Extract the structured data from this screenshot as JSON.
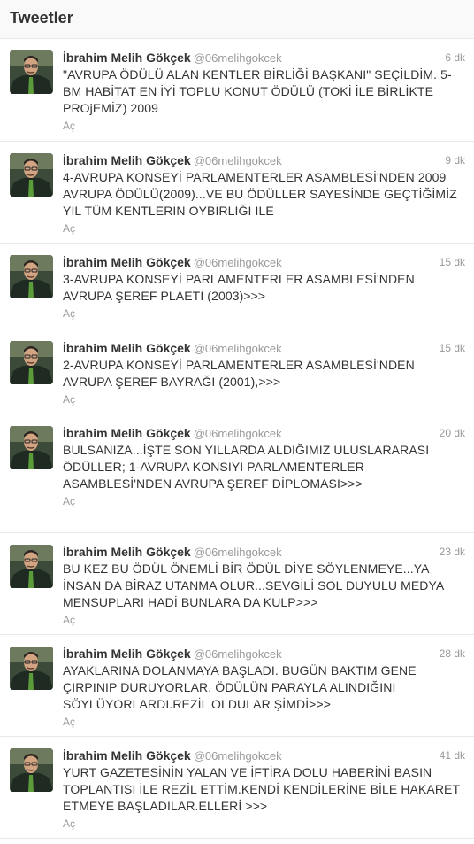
{
  "header": {
    "title": "Tweetler"
  },
  "author": {
    "name": "İbrahim Melih Gökçek",
    "handle": "@06melihgokcek"
  },
  "open_label": "Aç",
  "tweets": [
    {
      "time": "6 dk",
      "text": "\"AVRUPA ÖDÜLÜ ALAN KENTLER BİRLİĞİ BAŞKANI\" SEÇİLDİM. 5-BM HABİTAT EN İYİ TOPLU KONUT ÖDÜLÜ (TOKİ İLE BİRLİKTE PROjEMİZ) 2009"
    },
    {
      "time": "9 dk",
      "text": "4-AVRUPA KONSEYİ PARLAMENTERLER ASAMBLESİ'NDEN 2009 AVRUPA ÖDÜLÜ(2009)...VE BU ÖDÜLLER SAYESİNDE GEÇTİĞİMİZ YIL TÜM KENTLERİN OYBİRLİĞİ İLE"
    },
    {
      "time": "15 dk",
      "text": "3-AVRUPA KONSEYİ PARLAMENTERLER ASAMBLESİ'NDEN AVRUPA ŞEREF PLAETİ (2003)>>>"
    },
    {
      "time": "15 dk",
      "text": "2-AVRUPA KONSEYİ PARLAMENTERLER ASAMBLESİ'NDEN AVRUPA ŞEREF BAYRAĞI (2001),>>>"
    },
    {
      "time": "20 dk",
      "text": "BULSANIZA...İŞTE SON YILLARDA ALDIĞIMIZ ULUSLARARASI ÖDÜLLER; 1-AVRUPA KONSİYİ PARLAMENTERLER ASAMBLESİ'NDEN AVRUPA ŞEREF DİPLOMASI>>>"
    },
    {
      "time": "23 dk",
      "text": "BU KEZ BU ÖDÜL ÖNEMLİ BİR ÖDÜL DİYE SÖYLENMEYE...YA İNSAN DA BİRAZ UTANMA OLUR...SEVGİLİ SOL DUYULU MEDYA MENSUPLARI HADİ BUNLARA DA KULP>>>"
    },
    {
      "time": "28 dk",
      "text": "AYAKLARINA DOLANMAYA BAŞLADI. BUGÜN BAKTIM GENE ÇIRPINIP DURUYORLAR. ÖDÜLÜN PARAYLA ALINDIĞINI SÖYLÜYORLARDI.REZİL OLDULAR ŞİMDİ>>>"
    },
    {
      "time": "41 dk",
      "text": "YURT GAZETESİNİN YALAN VE İFTİRA DOLU HABERİNİ BASIN TOPLANTISI İLE REZİL ETTİM.KENDİ KENDİLERİNE BİLE HAKARET ETMEYE BAŞLADILAR.ELLERİ >>>"
    }
  ]
}
